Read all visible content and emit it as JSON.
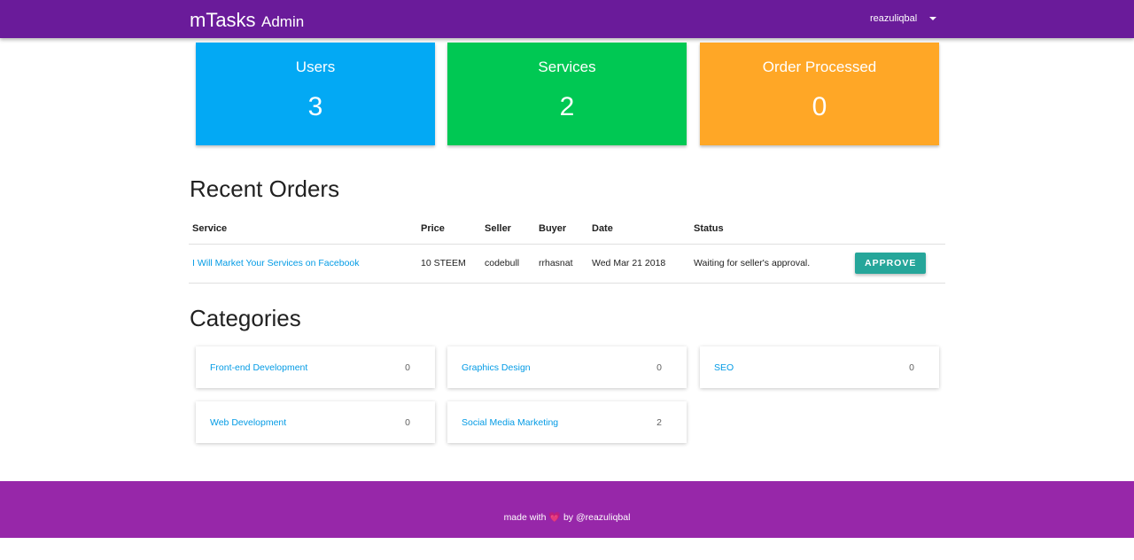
{
  "navbar": {
    "brand_main": "mTasks",
    "brand_sub": "Admin",
    "username": "reazuliqbal"
  },
  "stats": [
    {
      "label": "Users",
      "value": "3",
      "color": "#03a9f4"
    },
    {
      "label": "Services",
      "value": "2",
      "color": "#00c853"
    },
    {
      "label": "Order Processed",
      "value": "0",
      "color": "#ffa726"
    }
  ],
  "recent_orders": {
    "title": "Recent Orders",
    "headers": [
      "Service",
      "Price",
      "Seller",
      "Buyer",
      "Date",
      "Status"
    ],
    "rows": [
      {
        "service": "I Will Market Your Services on Facebook",
        "price": "10 STEEM",
        "seller": "codebull",
        "buyer": "rrhasnat",
        "date": "Wed Mar 21 2018",
        "status": "Waiting for seller's approval.",
        "action": "APPROVE"
      }
    ]
  },
  "categories": {
    "title": "Categories",
    "items": [
      {
        "name": "Front-end Development",
        "count": "0"
      },
      {
        "name": "Graphics Design",
        "count": "0"
      },
      {
        "name": "SEO",
        "count": "0"
      },
      {
        "name": "Web Development",
        "count": "0"
      },
      {
        "name": "Social Media Marketing",
        "count": "2"
      }
    ]
  },
  "footer": {
    "prefix": "made with",
    "heart": "💗",
    "suffix": "by @reazuliqbal"
  },
  "colors": {
    "navbar": "#6a1b9a",
    "footer": "#9727a9",
    "link": "#039be5",
    "approve": "#26a69a"
  }
}
